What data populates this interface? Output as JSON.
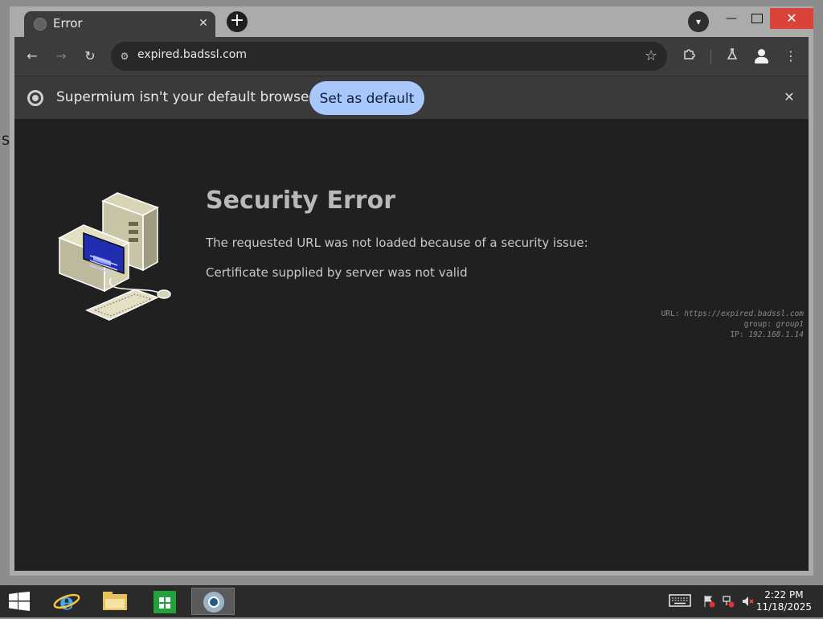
{
  "desktop": {
    "edge_letter": "S"
  },
  "browser": {
    "tab": {
      "title": "Error"
    },
    "address_bar": {
      "url": "expired.badssl.com"
    },
    "infobar": {
      "message": "Supermium isn't your default browser",
      "button_label": "Set as default"
    }
  },
  "page": {
    "title": "Security Error",
    "line1": "The requested URL was not loaded because of a security issue:",
    "line2": "Certificate supplied by server was not valid",
    "meta": {
      "url_label": "URL:",
      "url_value": "https://expired.badssl.com",
      "group_label": "group:",
      "group_value": "group1",
      "ip_label": "IP:",
      "ip_value": "192.168.1.14"
    }
  },
  "taskbar": {
    "clock": {
      "time": "2:22 PM",
      "date": "11/18/2025"
    }
  },
  "colors": {
    "accent_button": "#a8c7fa",
    "close_button": "#d9433a",
    "page_background": "#202020"
  }
}
